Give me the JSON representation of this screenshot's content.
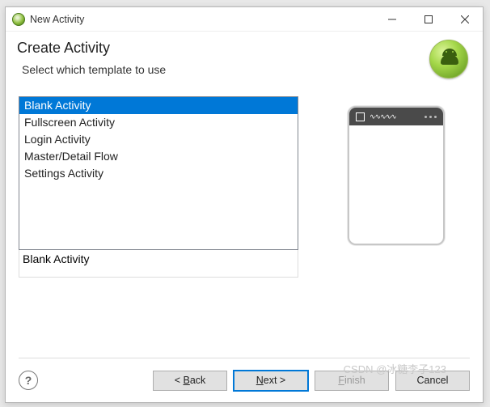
{
  "window": {
    "title": "New Activity"
  },
  "header": {
    "title": "Create Activity",
    "subtitle": "Select which template to use"
  },
  "templates": {
    "items": [
      "Blank Activity",
      "Fullscreen Activity",
      "Login Activity",
      "Master/Detail Flow",
      "Settings Activity"
    ],
    "selected_index": 0,
    "selected_label": "Blank Activity"
  },
  "buttons": {
    "back": "< Back",
    "next": "Next >",
    "finish": "Finish",
    "cancel": "Cancel",
    "finish_enabled": false
  },
  "watermark": "CSDN @冰糖李子123"
}
